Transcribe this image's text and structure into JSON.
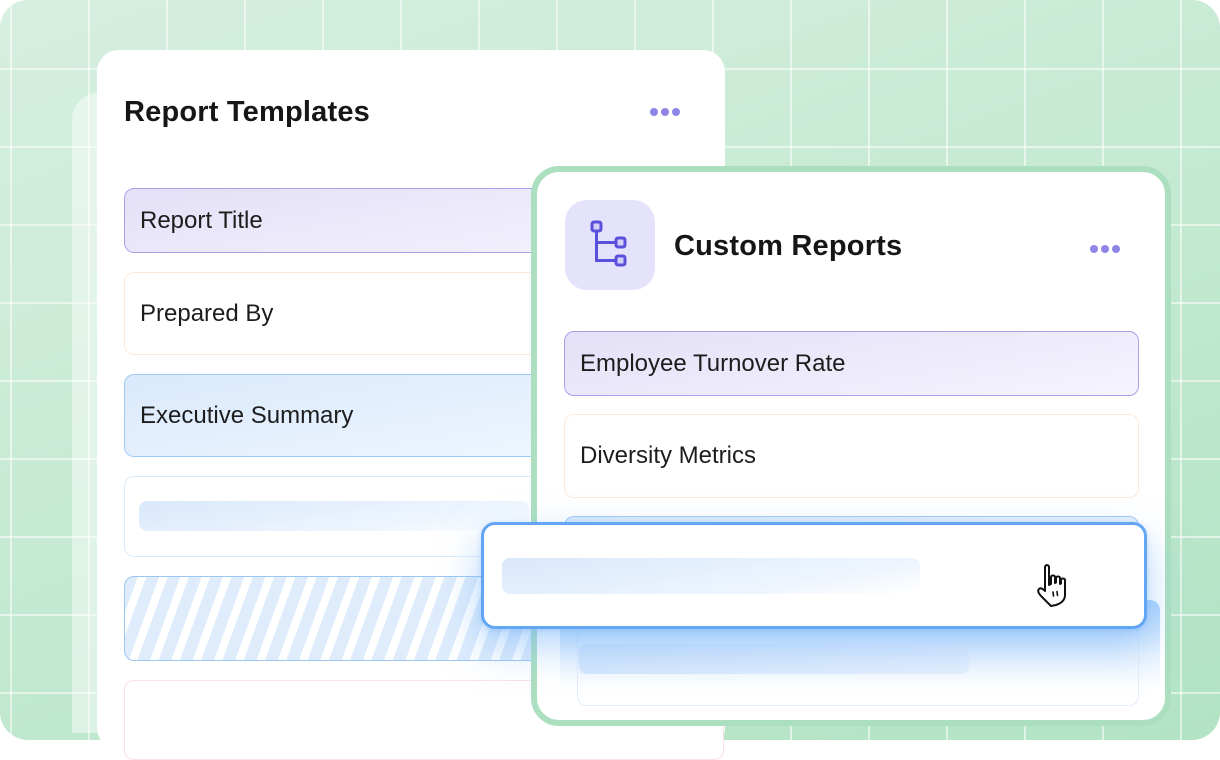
{
  "background": {
    "color": "#c7ead4",
    "grid_color": "#ffffff"
  },
  "report_templates": {
    "title": "Report Templates",
    "menu_icon": "more-horizontal-icon",
    "fields": [
      {
        "label": "Report Title",
        "style": "selected-purple"
      },
      {
        "label": "Prepared By",
        "style": "plain"
      },
      {
        "label": "Executive Summary",
        "style": "highlighted-blue"
      },
      {
        "label": "",
        "style": "skeleton"
      },
      {
        "label": "",
        "style": "drop-target-striped"
      },
      {
        "label": "",
        "style": "plain-pink"
      }
    ]
  },
  "custom_reports": {
    "title": "Custom Reports",
    "icon": "tree-structure-icon",
    "menu_icon": "more-horizontal-icon",
    "accent_color": "#5b4fd8",
    "fields": [
      {
        "label": "Employee Turnover Rate",
        "style": "selected-purple"
      },
      {
        "label": "Diversity Metrics",
        "style": "plain"
      },
      {
        "label": "",
        "style": "highlighted-blue"
      },
      {
        "label": "",
        "style": "skeleton"
      }
    ]
  },
  "dragged_item": {
    "label": "",
    "cursor": "hand-pointer-icon",
    "border_color": "#62a6f4"
  }
}
